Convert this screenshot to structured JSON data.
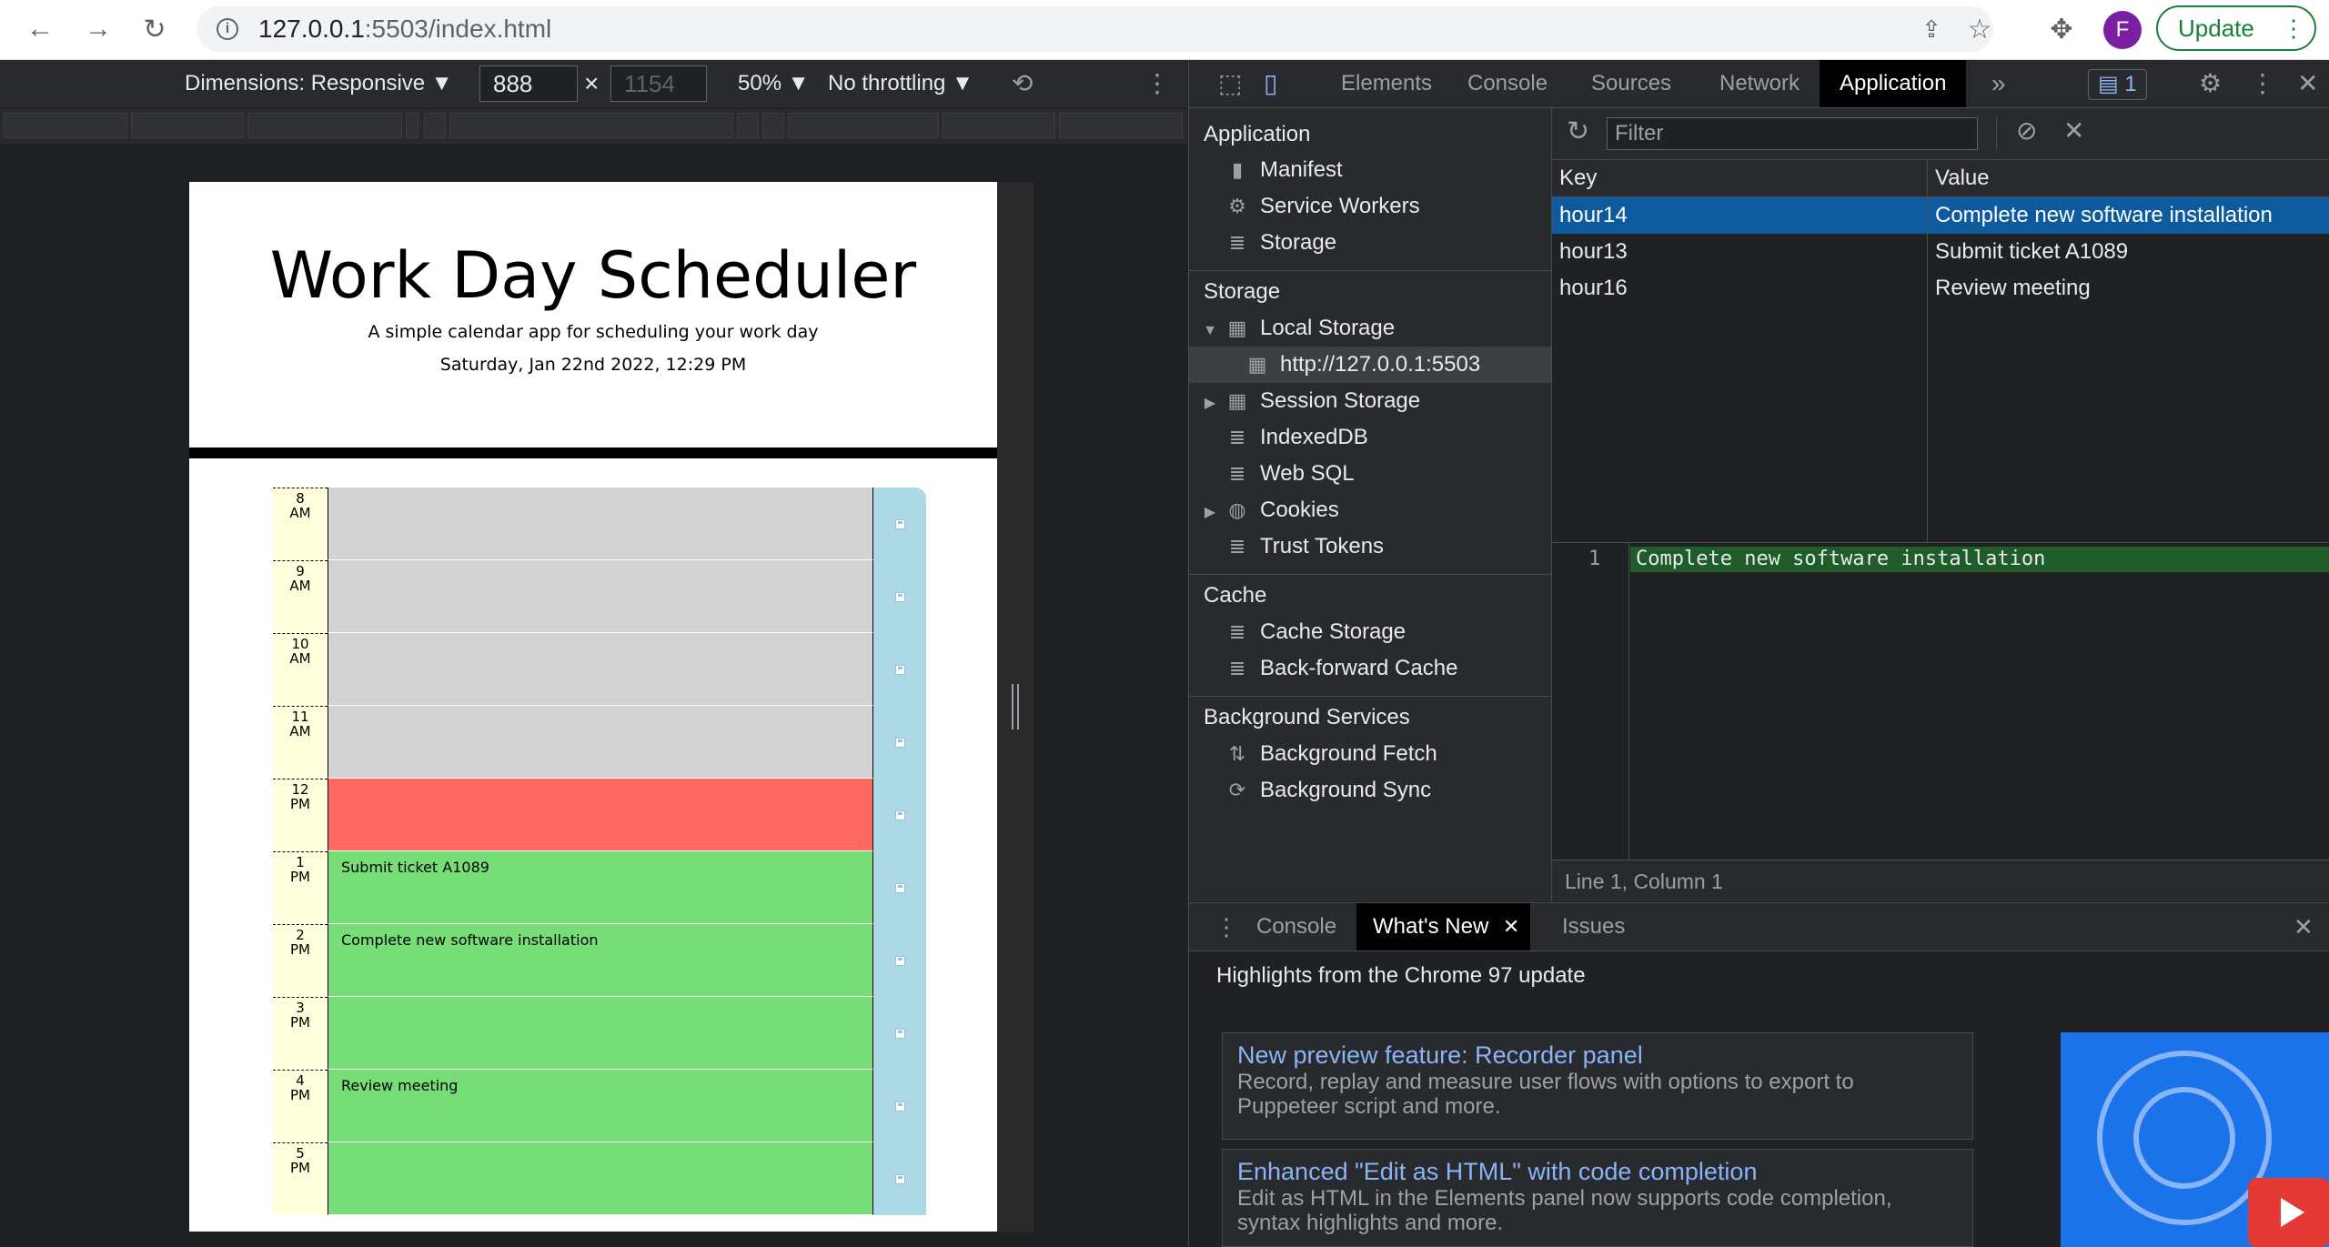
{
  "browser": {
    "url_host": "127.0.0.1",
    "url_rest": ":5503/index.html",
    "avatar_letter": "F",
    "update_label": "Update",
    "colors": {
      "update": "#188038",
      "avatar": "#7b1fa2"
    }
  },
  "device_toolbar": {
    "dimensions_label": "Dimensions: Responsive ▼",
    "width": "888",
    "height_placeholder": "1154",
    "times": "×",
    "zoom_label": "50% ▼",
    "throttle_label": "No throttling ▼"
  },
  "page": {
    "title": "Work Day Scheduler",
    "lead": "A simple calendar app for scheduling your work day",
    "date": "Saturday, Jan 22nd 2022, 12:29 PM",
    "rows": [
      {
        "hour": "8",
        "ampm": "AM",
        "text": "",
        "state": "past"
      },
      {
        "hour": "9",
        "ampm": "AM",
        "text": "",
        "state": "past"
      },
      {
        "hour": "10",
        "ampm": "AM",
        "text": "",
        "state": "past"
      },
      {
        "hour": "11",
        "ampm": "AM",
        "text": "",
        "state": "past"
      },
      {
        "hour": "12",
        "ampm": "PM",
        "text": "",
        "state": "present"
      },
      {
        "hour": "1",
        "ampm": "PM",
        "text": "Submit ticket A1089",
        "state": "future"
      },
      {
        "hour": "2",
        "ampm": "PM",
        "text": "Complete new software installation",
        "state": "future"
      },
      {
        "hour": "3",
        "ampm": "PM",
        "text": "",
        "state": "future"
      },
      {
        "hour": "4",
        "ampm": "PM",
        "text": "Review meeting",
        "state": "future"
      },
      {
        "hour": "5",
        "ampm": "PM",
        "text": "",
        "state": "future"
      }
    ],
    "colors": {
      "past": "#d3d3d3",
      "present": "#ff6961",
      "future": "#77dd77",
      "save": "#add8e6",
      "hour": "#ffffdd"
    }
  },
  "devtools": {
    "tabs": [
      "Elements",
      "Console",
      "Sources",
      "Network",
      "Application"
    ],
    "active_tab": "Application",
    "more_tabs": "»",
    "issues_count": "1",
    "sidebar": {
      "application_header": "Application",
      "application_items": [
        "Manifest",
        "Service Workers",
        "Storage"
      ],
      "storage_header": "Storage",
      "local_storage": "Local Storage",
      "local_storage_origin": "http://127.0.0.1:5503",
      "session_storage": "Session Storage",
      "indexeddb": "IndexedDB",
      "websql": "Web SQL",
      "cookies": "Cookies",
      "trust_tokens": "Trust Tokens",
      "cache_header": "Cache",
      "cache_items": [
        "Cache Storage",
        "Back-forward Cache"
      ],
      "bg_header": "Background Services",
      "bg_items": [
        "Background Fetch",
        "Background Sync"
      ]
    },
    "filter_placeholder": "Filter",
    "table": {
      "key_header": "Key",
      "value_header": "Value",
      "rows": [
        {
          "key": "hour14",
          "value": "Complete new software installation"
        },
        {
          "key": "hour13",
          "value": "Submit ticket A1089"
        },
        {
          "key": "hour16",
          "value": "Review meeting"
        }
      ]
    },
    "preview": {
      "line_number": "1",
      "text": "Complete new software installation"
    },
    "status": "Line 1, Column 1",
    "drawer": {
      "tabs": [
        "Console",
        "What's New",
        "Issues"
      ],
      "active_tab": "What's New",
      "highlights": "Highlights from the Chrome 97 update",
      "cards": [
        {
          "title": "New preview feature: Recorder panel",
          "desc": "Record, replay and measure user flows with options to export to Puppeteer script and more."
        },
        {
          "title": "Enhanced \"Edit as HTML\" with code completion",
          "desc": "Edit as HTML in the Elements panel now supports code completion, syntax highlights and more."
        }
      ]
    }
  }
}
